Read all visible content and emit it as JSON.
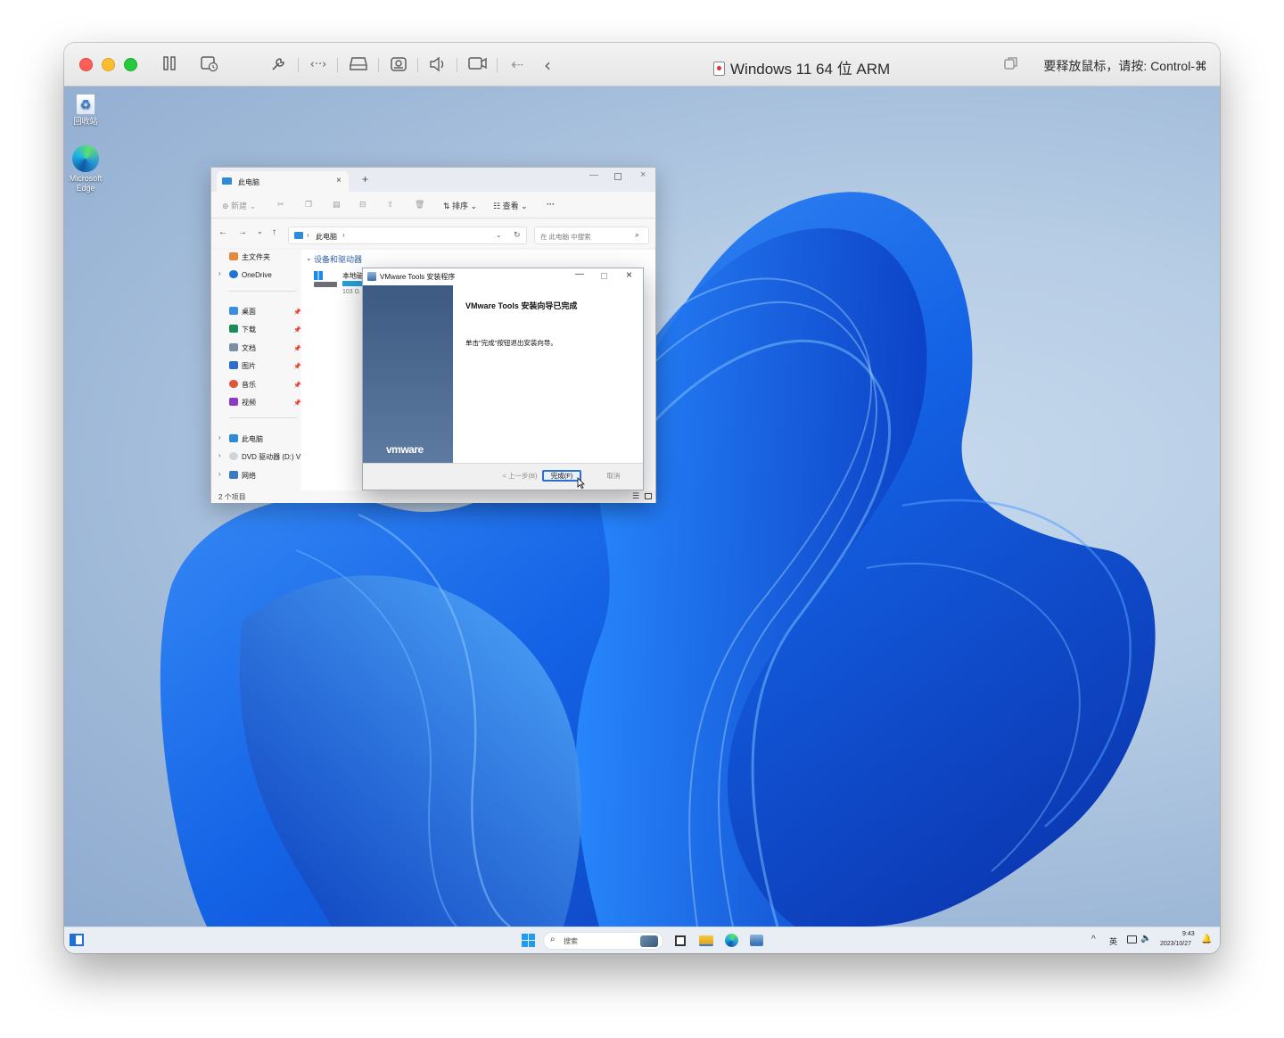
{
  "vm_window": {
    "title": "Windows 11 64 位 ARM",
    "release_hint": "要释放鼠标，请按: Control-⌘",
    "toolbar_icons": [
      "pause-icon",
      "snapshot-icon",
      "settings-wrench-icon",
      "code-brackets-icon",
      "drive-icon",
      "camera-icon",
      "speaker-icon",
      "video-icon",
      "usb-icon",
      "back-arrow-icon"
    ],
    "colors": {
      "close": "#ff5f57",
      "minimize": "#febc2e",
      "zoom": "#28c840"
    }
  },
  "desktop": {
    "icons": [
      {
        "label": "回收站",
        "icon": "recycle-bin-icon"
      },
      {
        "label": "Microsoft Edge",
        "icon": "edge-icon"
      }
    ]
  },
  "explorer": {
    "tab_title": "此电脑",
    "new_tab": "+",
    "commands": {
      "new": "新建",
      "sort": "排序",
      "view": "查看",
      "more": "···"
    },
    "breadcrumb": "此电脑",
    "search_placeholder": "在 此电脑 中搜索",
    "nav": {
      "home": "主文件夹",
      "onedrive": "OneDrive",
      "quick": [
        "桌面",
        "下载",
        "文档",
        "图片",
        "音乐",
        "视频"
      ],
      "this_pc": "此电脑",
      "dvd": "DVD 驱动器 (D:) V",
      "network": "网络"
    },
    "section_header": "设备和驱动器",
    "drive": {
      "name": "本地磁",
      "free": "103 G"
    },
    "status": "2 个项目"
  },
  "installer": {
    "title": "VMware Tools 安装程序",
    "heading": "VMware Tools 安装向导已完成",
    "message": "单击\"完成\"按钮退出安装向导。",
    "brand": "vmware",
    "buttons": {
      "back": "< 上一步(B)",
      "finish": "完成(F)",
      "cancel": "取消"
    }
  },
  "taskbar": {
    "search_label": "搜索",
    "ime": "英",
    "time": "9:43",
    "date": "2023/10/27"
  }
}
